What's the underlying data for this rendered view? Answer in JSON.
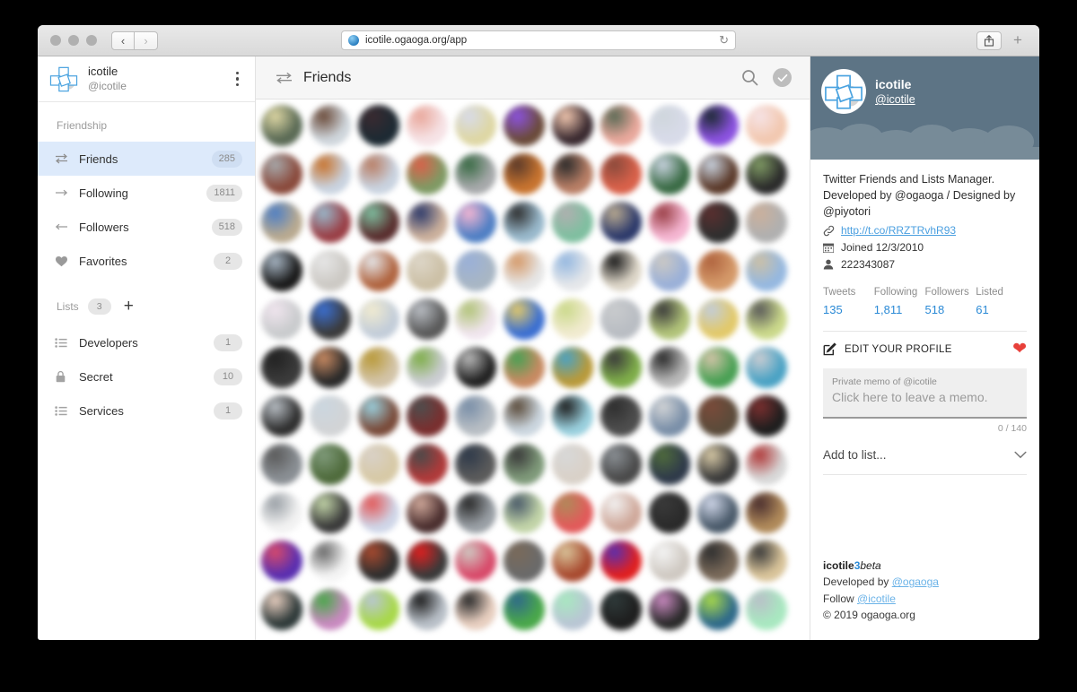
{
  "browser": {
    "url": "icotile.ogaoga.org/app",
    "reload_icon": "reload-icon",
    "favicon": "globe-icon",
    "back_label": "‹",
    "forward_label": "›",
    "share_icon": "share-icon",
    "newtab_label": "+"
  },
  "sidebar": {
    "account": {
      "name": "icotile",
      "handle": "@icotile",
      "menu_icon": "kebab-menu-icon"
    },
    "section_label": "Friendship",
    "items": [
      {
        "label": "Friends",
        "count": "285",
        "icon": "swap-arrows-icon",
        "active": true
      },
      {
        "label": "Following",
        "count": "1811",
        "icon": "arrow-right-icon",
        "active": false
      },
      {
        "label": "Followers",
        "count": "518",
        "icon": "arrow-left-icon",
        "active": false
      },
      {
        "label": "Favorites",
        "count": "2",
        "icon": "heart-icon",
        "active": false
      }
    ],
    "lists_label": "Lists",
    "lists_count": "3",
    "add_list_label": "+",
    "lists": [
      {
        "label": "Developers",
        "count": "1",
        "icon": "list-icon"
      },
      {
        "label": "Secret",
        "count": "10",
        "icon": "lock-icon"
      },
      {
        "label": "Services",
        "count": "1",
        "icon": "list-icon"
      }
    ]
  },
  "main": {
    "title": "Friends",
    "title_icon": "swap-arrows-icon",
    "search_icon": "search-icon",
    "select_icon": "check-circle-icon",
    "grid_columns": 11,
    "grid_rows": 11,
    "avatar_colors": [
      [
        "#5a6a55",
        "#cfd6dc",
        "#1d2a33",
        "#f6e3e6",
        "#ded7a4",
        "#6b4b3a",
        "#3a2a30",
        "#e9a89c",
        "#d8dbe9",
        "#8b52e0",
        "#f2c8b0"
      ],
      [
        "#8a4a3c",
        "#c9d3e0",
        "#c9d3e0",
        "#7f9a64",
        "#a7a9ab",
        "#c8742f",
        "#b97f66",
        "#d9614a",
        "#3a6b45",
        "#5b3a2a",
        "#2b2b2b"
      ],
      [
        "#b9aa90",
        "#9a3f46",
        "#5a2f2f",
        "#cbb09c",
        "#4f7fc4",
        "#99b9cc",
        "#7fbfa0",
        "#2d3a6b",
        "#f5b6d2",
        "#2f2f2f",
        "#b0b0b0"
      ],
      [
        "#1a1a1a",
        "#ccc9c4",
        "#b0643f",
        "#ccc0a6",
        "#a8b6c4",
        "#e6e6e6",
        "#e5e7ea",
        "#ddd6c8",
        "#9ab0d8",
        "#d59a6a",
        "#95b8e0"
      ],
      [
        "#c9cbcd",
        "#3b3b3b",
        "#c3cdd9",
        "#5a5a5a",
        "#f0e5ee",
        "#3b6fd1",
        "#f1ebd0",
        "#b9bdc3",
        "#b2c47a",
        "#e2c96a",
        "#cbd98b"
      ],
      [
        "#3b3b3b",
        "#2a2a2a",
        "#d3c4a8",
        "#cbcdd2",
        "#222222",
        "#c88a62",
        "#b99a3a",
        "#7fae4a",
        "#b9b9b9",
        "#49a054",
        "#4aa2c4"
      ],
      [
        "#2f2f2f",
        "#d2d4d6",
        "#7a4b3a",
        "#7a2f2f",
        "#b8bec4",
        "#cbd6df",
        "#9ad0de",
        "#4e4e4e",
        "#7a8fa8",
        "#5b4b3a",
        "#1e1e1e"
      ],
      [
        "#8a8f94",
        "#4f6b3c",
        "#d7c9a6",
        "#b03a3a",
        "#5b5b5b",
        "#7f9a7a",
        "#d9d1c8",
        "#4a4a4a",
        "#2f3a4a",
        "#3a3a3a",
        "#d8d8d8"
      ],
      [
        "#f2f2f2",
        "#3a3a3a",
        "#cfd6e8",
        "#4b2f2f",
        "#9aa0a6",
        "#c2d4a8",
        "#e25a5a",
        "#cfa89a",
        "#2a2a2a",
        "#4a5a6a",
        "#b08a5a"
      ],
      [
        "#5a2fb0",
        "#f4f4f4",
        "#2f2f2f",
        "#3a3a3a",
        "#d84a6a",
        "#6a6a6a",
        "#a84a2f",
        "#e02020",
        "#cfc9c2",
        "#7a6a5a",
        "#d9c49a"
      ],
      [
        "#2f3a3a",
        "#c98ac0",
        "#a8d84a",
        "#b9c0c8",
        "#e8cfc0",
        "#4aa84a",
        "#b9c6d4",
        "#1e1e1e",
        "#2a2a2a",
        "#2f6a8a",
        "#a8e8c0"
      ]
    ]
  },
  "profile": {
    "name": "icotile",
    "handle": "@icotile",
    "bio": "Twitter Friends and Lists Manager.  Developed by @ogaoga / Designed by @piyotori",
    "link": {
      "icon": "link-icon",
      "text": "http://t.co/RRZTRvhR93"
    },
    "joined": {
      "icon": "calendar-icon",
      "text": "Joined 12/3/2010"
    },
    "user_id": {
      "icon": "person-icon",
      "text": "222343087"
    },
    "stats": [
      {
        "key": "Tweets",
        "value": "135"
      },
      {
        "key": "Following",
        "value": "1,811"
      },
      {
        "key": "Followers",
        "value": "518"
      },
      {
        "key": "Listed",
        "value": "61"
      }
    ],
    "edit_label": "EDIT YOUR PROFILE",
    "edit_icon": "edit-pencil-icon",
    "heart_icon": "heart-icon",
    "memo": {
      "label": "Private memo of @icotile",
      "placeholder": "Click here to leave a memo.",
      "counter": "0 / 140"
    },
    "add_to_list": {
      "label": "Add to list...",
      "chevron": "chevron-down-icon"
    },
    "footer": {
      "brand_a": "icotile",
      "brand_b": "3",
      "brand_c": "beta",
      "dev_prefix": "Developed by ",
      "dev_link": "@ogaoga",
      "follow_prefix": "Follow ",
      "follow_link": "@icotile",
      "copyright": "© 2019 ogaoga.org"
    }
  },
  "colors": {
    "accent": "#2b8ad6",
    "active_bg": "#ddeafb",
    "heart": "#e8403a",
    "banner": "#5d7485"
  }
}
